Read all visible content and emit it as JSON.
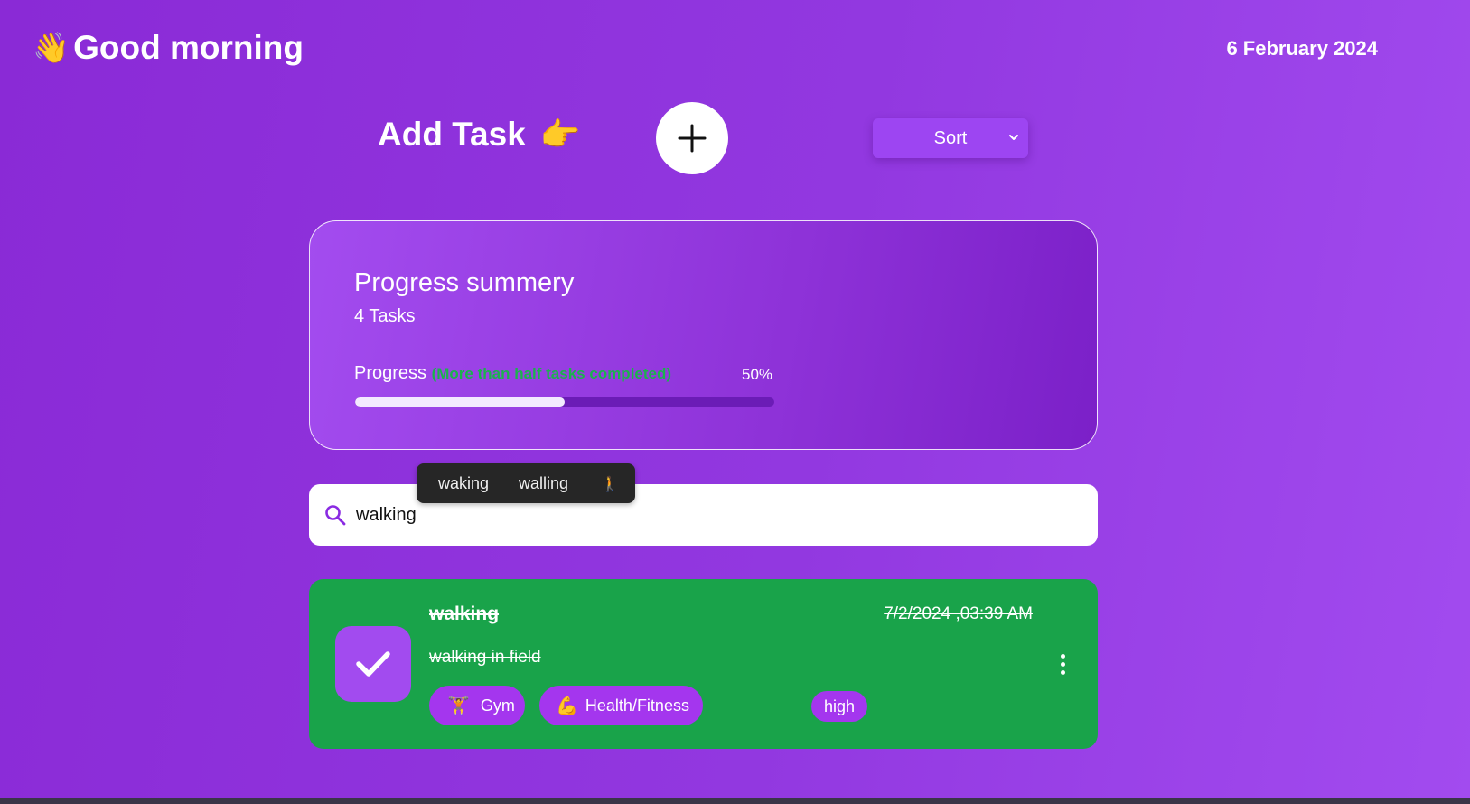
{
  "header": {
    "greeting_emoji": "👋",
    "greeting": "Good morning",
    "date": "6 February 2024"
  },
  "add_task": {
    "label": "Add Task",
    "emoji": "👉",
    "icon": "plus-icon"
  },
  "sort": {
    "selected": "Sort",
    "icon": "chevron-down-icon"
  },
  "progress": {
    "title": "Progress summery",
    "tasks_count": "4 Tasks",
    "label": "Progress",
    "note": "(More than half tasks completed)",
    "percent_text": "50%",
    "value": 0.5,
    "note_color": "#1bb34d"
  },
  "search": {
    "value": "walking",
    "icon": "search-icon",
    "suggestions": [
      "waking",
      "walling",
      "🚶"
    ]
  },
  "task": {
    "title": "walking",
    "date": "7/2/2024 ,03:39 AM",
    "description": "walking in field",
    "completed": true,
    "card_color": "#19a34a",
    "categories": [
      {
        "emoji": "🏋",
        "label": "Gym"
      },
      {
        "emoji": "💪",
        "label": "Health/Fitness"
      }
    ],
    "priority": "high"
  },
  "colors": {
    "accent": "#a24bef",
    "background": "#8a2ad6",
    "completed": "#19a34a"
  }
}
